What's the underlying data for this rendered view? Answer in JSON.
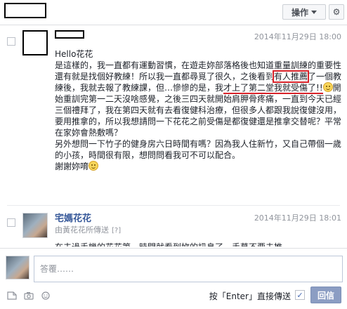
{
  "header": {
    "actions_label": "操作",
    "gear_glyph": "⚙"
  },
  "messages": [
    {
      "timestamp": "2014年11月29日 18:00",
      "greeting": "Hello花花",
      "seg_intro": "是這樣的，我一直都有運動習慣，在遊走妳部落格後也知道重量訓練的重要性還有就是找個好教練！所以我一直都尋覓了很久，之後看到",
      "seg_box": "有人推薦",
      "seg_mid": "了一個教練後，我就去報了教練課，但…慘慘的是，我",
      "seg_underline": "才上了第二堂我就受傷了!!",
      "seg_after": "開始重訓完第一二天沒啥感覺，之後三四天就開始肩胛骨疼痛，一直到今天已經三個禮拜了，我在第四天就有去看復健科治療，但很多人都跟我說復健沒用，要用推拿的，所以我想請問一下花花之前受傷是都復健還是推拿交替呢？平常在家妳會熱敷嗎？",
      "para2": "另外想問一下竹子的健身房六日時間有嗎？因為我人住新竹，又自己帶個一歲的小孩，時間很有限，想問問看我可不可以配合。",
      "closing": "謝謝妳唷"
    },
    {
      "sender": "宅媽花花",
      "timestamp": "2014年11月29日 18:01",
      "forwarded_label": "由黃花花所傳送",
      "forwarded_q": "[?]",
      "preview": "在去過手機的花花第一時間就看到妳的訊息了，手莫不要去推"
    }
  ],
  "composer": {
    "placeholder": "答覆……",
    "send_hint": "按「Enter」直接傳送",
    "enter_checked": "✓",
    "reply_label": "回信"
  }
}
